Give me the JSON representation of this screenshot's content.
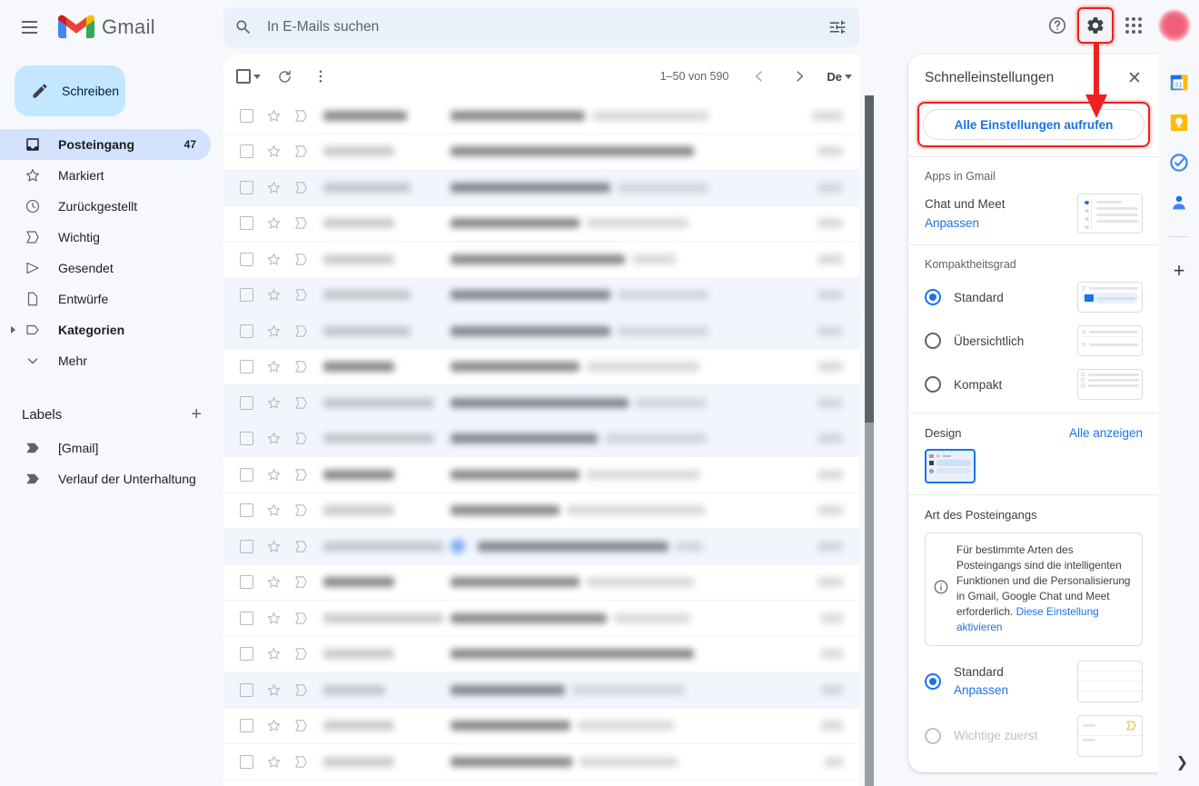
{
  "app": {
    "brand": "Gmail",
    "menu_icon": "hamburger-icon",
    "logo_icon": "gmail-logo-icon"
  },
  "search": {
    "placeholder": "In E-Mails suchen",
    "value": "",
    "icon": "search-icon",
    "options_icon": "search-options-icon"
  },
  "header_actions": {
    "help": "?",
    "help_icon": "help-icon",
    "settings_icon": "gear-icon",
    "apps_icon": "apps-grid-icon",
    "avatar_icon": "avatar"
  },
  "sidebar": {
    "compose": {
      "label": "Schreiben",
      "icon": "pencil-icon"
    },
    "items": [
      {
        "label": "Posteingang",
        "icon": "inbox-icon",
        "count": "47",
        "active": true
      },
      {
        "label": "Markiert",
        "icon": "star-icon",
        "count": ""
      },
      {
        "label": "Zurückgestellt",
        "icon": "clock-icon",
        "count": ""
      },
      {
        "label": "Wichtig",
        "icon": "important-chevron-icon",
        "count": ""
      },
      {
        "label": "Gesendet",
        "icon": "send-icon",
        "count": ""
      },
      {
        "label": "Entwürfe",
        "icon": "draft-icon",
        "count": ""
      },
      {
        "label": "Kategorien",
        "icon": "label-icon",
        "count": ""
      },
      {
        "label": "Mehr",
        "icon": "chevron-down-icon",
        "count": ""
      }
    ],
    "labels_header": "Labels",
    "add_label": "+",
    "labels": [
      {
        "label": "[Gmail]",
        "icon": "label-tag-icon"
      },
      {
        "label": "Verlauf der Unterhaltung",
        "icon": "label-tag-icon"
      }
    ]
  },
  "list_toolbar": {
    "select_all_icon": "checkbox-icon",
    "select_caret_icon": "chevron-down-icon",
    "refresh_icon": "refresh-icon",
    "more_icon": "more-vertical-icon",
    "pager_text": "1–50 von 590",
    "prev_icon": "chevron-left-icon",
    "next_icon": "chevron-right-icon",
    "language": "De",
    "language_caret_icon": "chevron-down-icon"
  },
  "mail_rows": [
    {
      "tinted": false,
      "sender_w": 92,
      "sender_dark": true,
      "subject_w": 148,
      "snippet_w": 128,
      "time_w": 34,
      "avatar": false
    },
    {
      "tinted": false,
      "sender_w": 78,
      "sender_dark": false,
      "subject_w": 268,
      "snippet_w": 0,
      "time_w": 28,
      "avatar": false
    },
    {
      "tinted": true,
      "sender_w": 96,
      "sender_dark": false,
      "subject_w": 176,
      "snippet_w": 100,
      "time_w": 28,
      "avatar": false
    },
    {
      "tinted": false,
      "sender_w": 78,
      "sender_dark": false,
      "subject_w": 142,
      "snippet_w": 112,
      "time_w": 28,
      "avatar": false
    },
    {
      "tinted": false,
      "sender_w": 78,
      "sender_dark": false,
      "subject_w": 192,
      "snippet_w": 48,
      "time_w": 28,
      "avatar": false
    },
    {
      "tinted": true,
      "sender_w": 96,
      "sender_dark": false,
      "subject_w": 176,
      "snippet_w": 100,
      "time_w": 28,
      "avatar": false
    },
    {
      "tinted": true,
      "sender_w": 96,
      "sender_dark": false,
      "subject_w": 176,
      "snippet_w": 100,
      "time_w": 28,
      "avatar": false
    },
    {
      "tinted": false,
      "sender_w": 78,
      "sender_dark": true,
      "subject_w": 142,
      "snippet_w": 124,
      "time_w": 28,
      "avatar": false
    },
    {
      "tinted": true,
      "sender_w": 122,
      "sender_dark": false,
      "subject_w": 196,
      "snippet_w": 78,
      "time_w": 28,
      "avatar": false
    },
    {
      "tinted": true,
      "sender_w": 122,
      "sender_dark": false,
      "subject_w": 162,
      "snippet_w": 112,
      "time_w": 28,
      "avatar": false
    },
    {
      "tinted": false,
      "sender_w": 78,
      "sender_dark": true,
      "subject_w": 142,
      "snippet_w": 124,
      "time_w": 28,
      "avatar": false
    },
    {
      "tinted": false,
      "sender_w": 78,
      "sender_dark": false,
      "subject_w": 120,
      "snippet_w": 152,
      "time_w": 28,
      "avatar": false
    },
    {
      "tinted": true,
      "sender_w": 132,
      "sender_dark": false,
      "subject_w": 210,
      "snippet_w": 30,
      "time_w": 28,
      "avatar": true
    },
    {
      "tinted": false,
      "sender_w": 78,
      "sender_dark": true,
      "subject_w": 142,
      "snippet_w": 118,
      "time_w": 28,
      "avatar": false
    },
    {
      "tinted": false,
      "sender_w": 132,
      "sender_dark": false,
      "subject_w": 172,
      "snippet_w": 84,
      "time_w": 24,
      "avatar": false
    },
    {
      "tinted": false,
      "sender_w": 78,
      "sender_dark": false,
      "subject_w": 268,
      "snippet_w": 0,
      "time_w": 24,
      "avatar": false
    },
    {
      "tinted": true,
      "sender_w": 68,
      "sender_dark": false,
      "subject_w": 126,
      "snippet_w": 124,
      "time_w": 24,
      "avatar": false
    },
    {
      "tinted": false,
      "sender_w": 78,
      "sender_dark": false,
      "subject_w": 132,
      "snippet_w": 106,
      "time_w": 24,
      "avatar": false
    },
    {
      "tinted": false,
      "sender_w": 78,
      "sender_dark": false,
      "subject_w": 134,
      "snippet_w": 108,
      "time_w": 20,
      "avatar": false
    }
  ],
  "settings_panel": {
    "title": "Schnelleinstellungen",
    "close_icon": "close-icon",
    "all_settings_button": "Alle Einstellungen aufrufen",
    "apps_section": {
      "title": "Apps in Gmail",
      "option_label": "Chat und Meet",
      "customize_link": "Anpassen"
    },
    "density_section": {
      "title": "Kompaktheitsgrad",
      "options": [
        {
          "label": "Standard",
          "selected": true
        },
        {
          "label": "Übersichtlich",
          "selected": false
        },
        {
          "label": "Kompakt",
          "selected": false
        }
      ]
    },
    "theme_section": {
      "title": "Design",
      "view_all": "Alle anzeigen",
      "thumb_brand": "Gmail"
    },
    "inbox_section": {
      "title": "Art des Posteingangs",
      "info_icon": "info-icon",
      "info_text_part1": "Für bestimmte Arten des Posteingangs sind die intelligenten Funktionen und die Personalisierung in Gmail, Google Chat und Meet erforderlich. ",
      "info_link": "Diese Einstellung aktivieren",
      "options": [
        {
          "label": "Standard",
          "link": "Anpassen",
          "selected": true,
          "disabled": false
        },
        {
          "label": "Wichtige zuerst",
          "link": "",
          "selected": false,
          "disabled": true
        }
      ]
    }
  },
  "right_rail": {
    "items": [
      {
        "name": "calendar-icon",
        "label": "31"
      },
      {
        "name": "keep-icon",
        "label": ""
      },
      {
        "name": "tasks-icon",
        "label": ""
      },
      {
        "name": "contacts-icon",
        "label": ""
      }
    ],
    "add_icon": "+",
    "expand_icon": "chevron-right-icon"
  },
  "annotations": {
    "arrow_color": "#f02020",
    "highlight_color": "#f02020"
  },
  "colors": {
    "accent": "#1a73e8",
    "compose_bg": "#c2e7ff",
    "active_nav_bg": "#d3e3fd",
    "page_bg": "#f6f8fc"
  }
}
